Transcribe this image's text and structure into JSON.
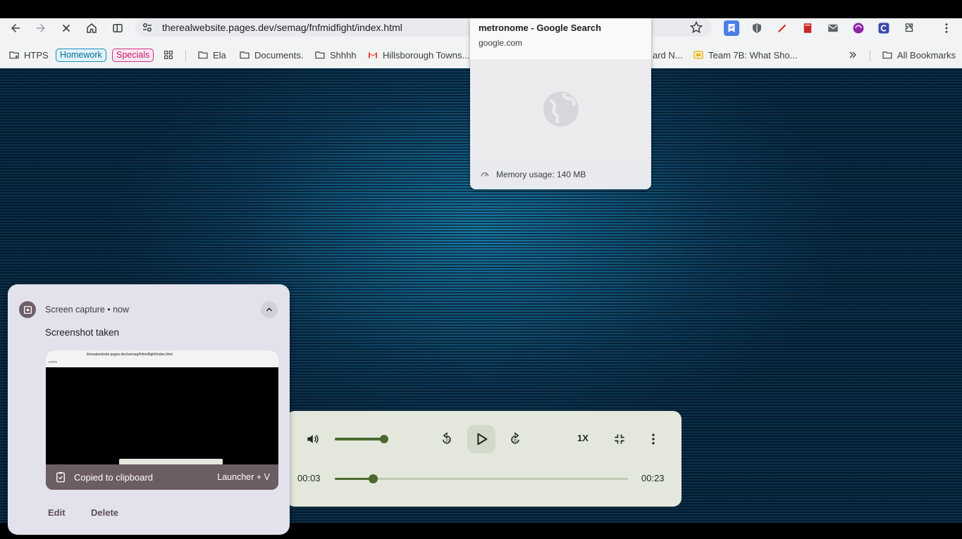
{
  "browser": {
    "url": "therealwebsite.pages.dev/semag/fnfmidfight/index.html",
    "bookmarks": {
      "htps": "HTPS",
      "homework": "Homework",
      "specials": "Specials",
      "ela": "Ela",
      "documents": "Documents.",
      "shhhh": "Shhhh",
      "hillsborough": "Hillsborough Towns...",
      "partial": "ard N...",
      "team7b": "Team 7B: What Sho...",
      "all_bookmarks": "All Bookmarks"
    }
  },
  "tab_hover_card": {
    "title": "metronome - Google Search",
    "domain": "google.com",
    "memory": "Memory usage: 140 MB"
  },
  "media_player": {
    "speed_label": "1X",
    "elapsed": "00:03",
    "duration": "00:23",
    "progress_fraction": 0.13,
    "volume_fraction": 0.9
  },
  "notification": {
    "app": "Screen capture • now",
    "title": "Screenshot taken",
    "clipboard_text": "Copied to clipboard",
    "shortcut": "Launcher + V",
    "edit_label": "Edit",
    "delete_label": "Delete"
  },
  "colors": {
    "accent_green": "#4a6930",
    "notification_brown": "#6c5c64",
    "homework_chip": "#1a8bb8",
    "specials_chip": "#d12e8a"
  }
}
